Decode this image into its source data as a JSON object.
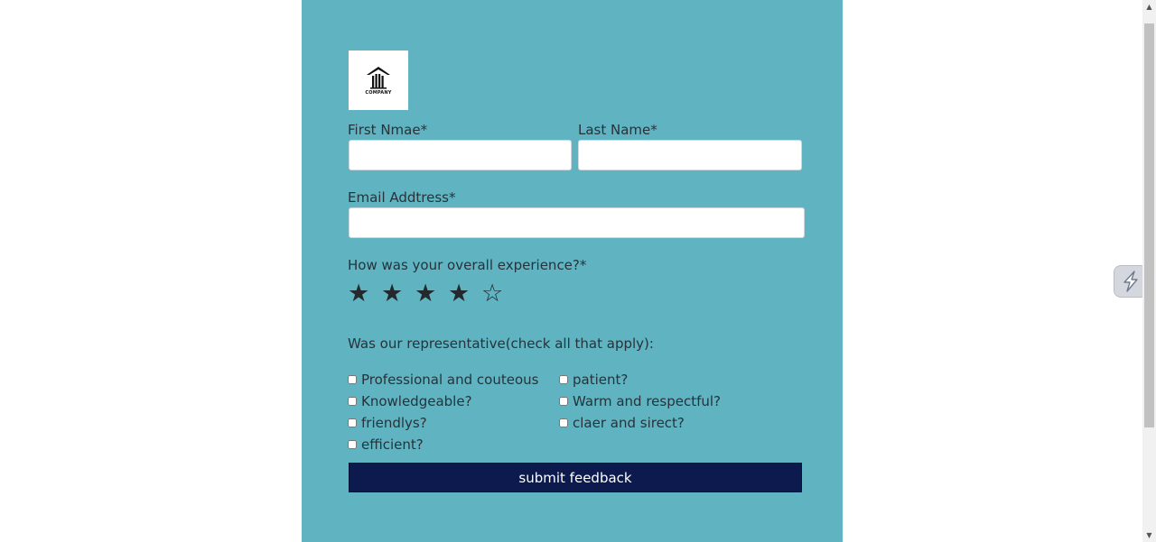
{
  "form": {
    "logo_alt": "COMPANY",
    "first_name_label": "First Nmae*",
    "last_name_label": "Last Name*",
    "email_label": "Email Addtress*",
    "experience_label": "How was your overall experience?*",
    "rating": {
      "value": 4,
      "max": 5,
      "filled_glyph": "★",
      "empty_glyph": "☆"
    },
    "representative_label": "Was our representative(check all that apply):",
    "checkboxes": {
      "left": [
        "Professional and couteous",
        "Knowledgeable?",
        "friendlys?",
        "efficient?"
      ],
      "right": [
        "patient?",
        "Warm and respectful?",
        "claer and sirect?"
      ]
    },
    "submit_label": "submit feedback"
  },
  "colors": {
    "card_bg": "#60b3c1",
    "submit_bg": "#0c1a4d",
    "text": "#26333a"
  },
  "icons": {
    "logo": "building-columns-icon",
    "extension": "lightning-bolt-icon",
    "scroll_up": "chevron-up-icon",
    "scroll_down": "chevron-down-icon"
  }
}
